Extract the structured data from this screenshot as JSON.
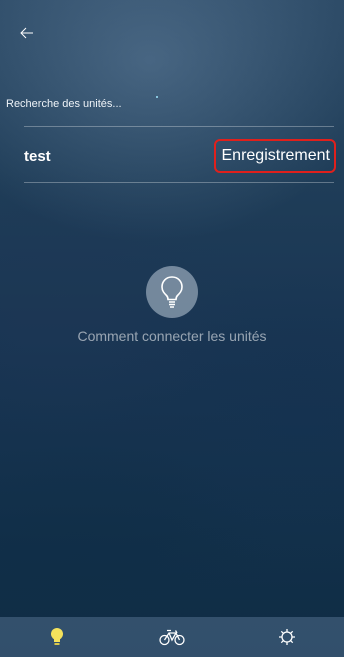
{
  "header": {
    "back_icon": "arrow-left-icon",
    "searching_label": "Recherche des unités..."
  },
  "devices": [
    {
      "name": "test",
      "action_label": "Enregistrement"
    }
  ],
  "help": {
    "icon": "lightbulb-icon",
    "label": "Comment connecter les unités"
  },
  "tabbar": {
    "tabs": [
      {
        "icon": "lightbulb-icon",
        "active": true
      },
      {
        "icon": "bicycle-icon",
        "active": false
      },
      {
        "icon": "gear-icon",
        "active": false
      }
    ]
  },
  "colors": {
    "highlight_border": "#e0201c",
    "active_tab": "#f4e25c",
    "inactive_tab": "#ffffff"
  }
}
